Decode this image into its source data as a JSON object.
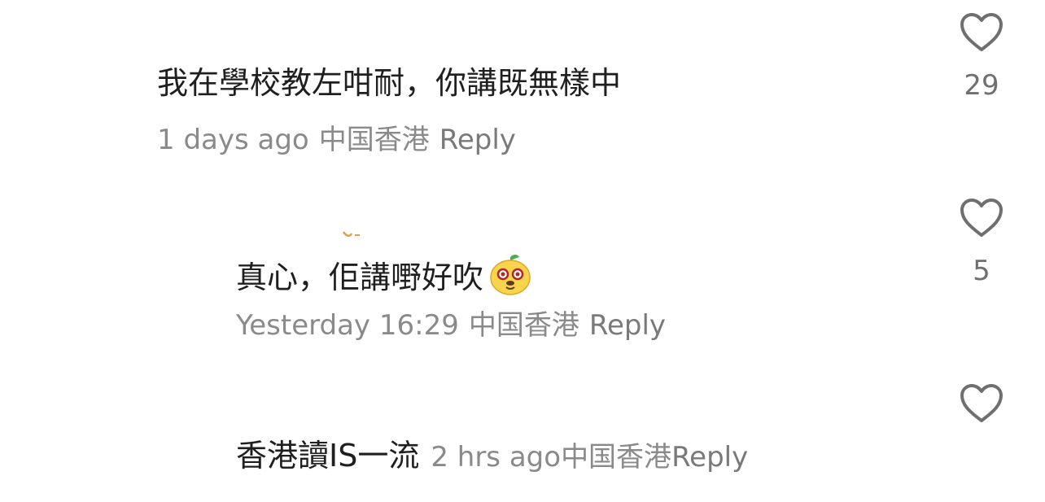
{
  "comments": [
    {
      "text": "我在學校教左咁耐，你講既無樣中",
      "time": "1 days ago",
      "location": "中国香港",
      "reply_label": "Reply",
      "likes": "29"
    },
    {
      "text": "真心，佢講嘢好吹",
      "emoji": "lion-face-emoji",
      "time": "Yesterday 16:29",
      "location": "中国香港",
      "reply_label": "Reply",
      "likes": "5"
    },
    {
      "text": "香港讀IS一流",
      "time": "2 hrs ago",
      "location": "中国香港",
      "reply_label": "Reply",
      "likes": ""
    }
  ],
  "icons": {
    "like": "heart-outline-icon"
  },
  "colors": {
    "text": "#1f1f1f",
    "meta": "#8a8a8a",
    "icon": "#6f6f6f"
  }
}
